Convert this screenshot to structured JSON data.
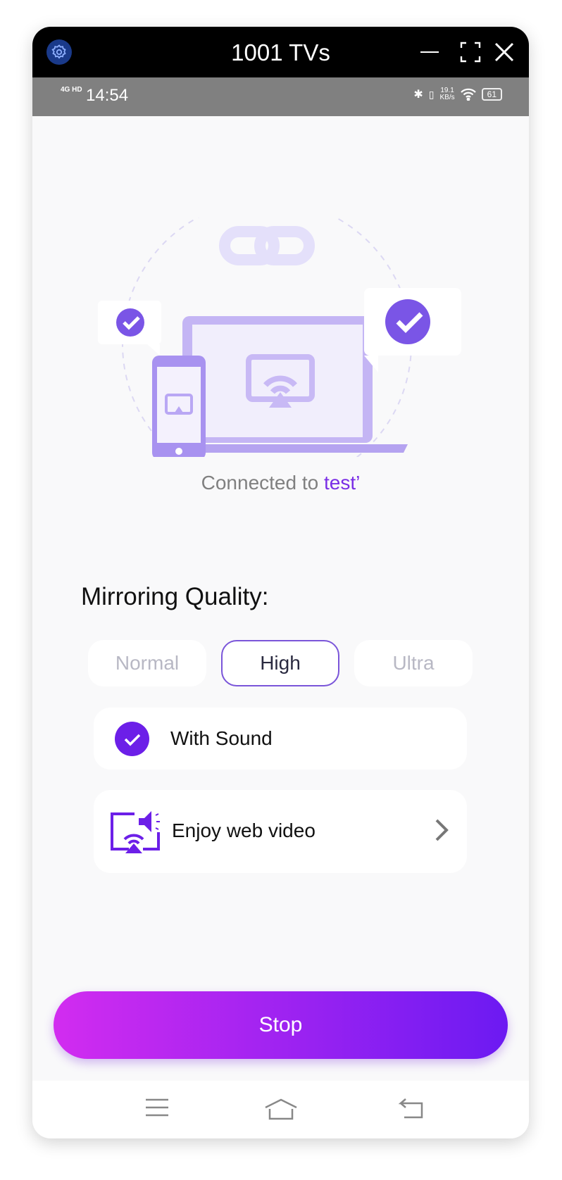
{
  "window": {
    "title": "1001 TVs",
    "settings_icon": "gear-icon",
    "minimize_icon": "minimize-icon",
    "fullscreen_icon": "fullscreen-icon",
    "close_icon": "close-icon"
  },
  "status_bar": {
    "network": "4G HD",
    "time": "14:54",
    "speed_value": "19.1",
    "speed_unit": "KB/s",
    "battery": "61"
  },
  "connection": {
    "prefix": "Connected to ",
    "device": "test’",
    "accent": "#7a2ee6"
  },
  "quality": {
    "label": "Mirroring Quality:",
    "options": [
      "Normal",
      "High",
      "Ultra"
    ],
    "selected": "High"
  },
  "with_sound": {
    "label": "With Sound",
    "checked": true
  },
  "web_video": {
    "label": "Enjoy web video"
  },
  "stop_button": {
    "label": "Stop",
    "gradient": [
      "#d22cf0",
      "#6c1af2"
    ]
  },
  "nav": {
    "icons": [
      "menu-icon",
      "home-icon",
      "back-icon"
    ]
  }
}
